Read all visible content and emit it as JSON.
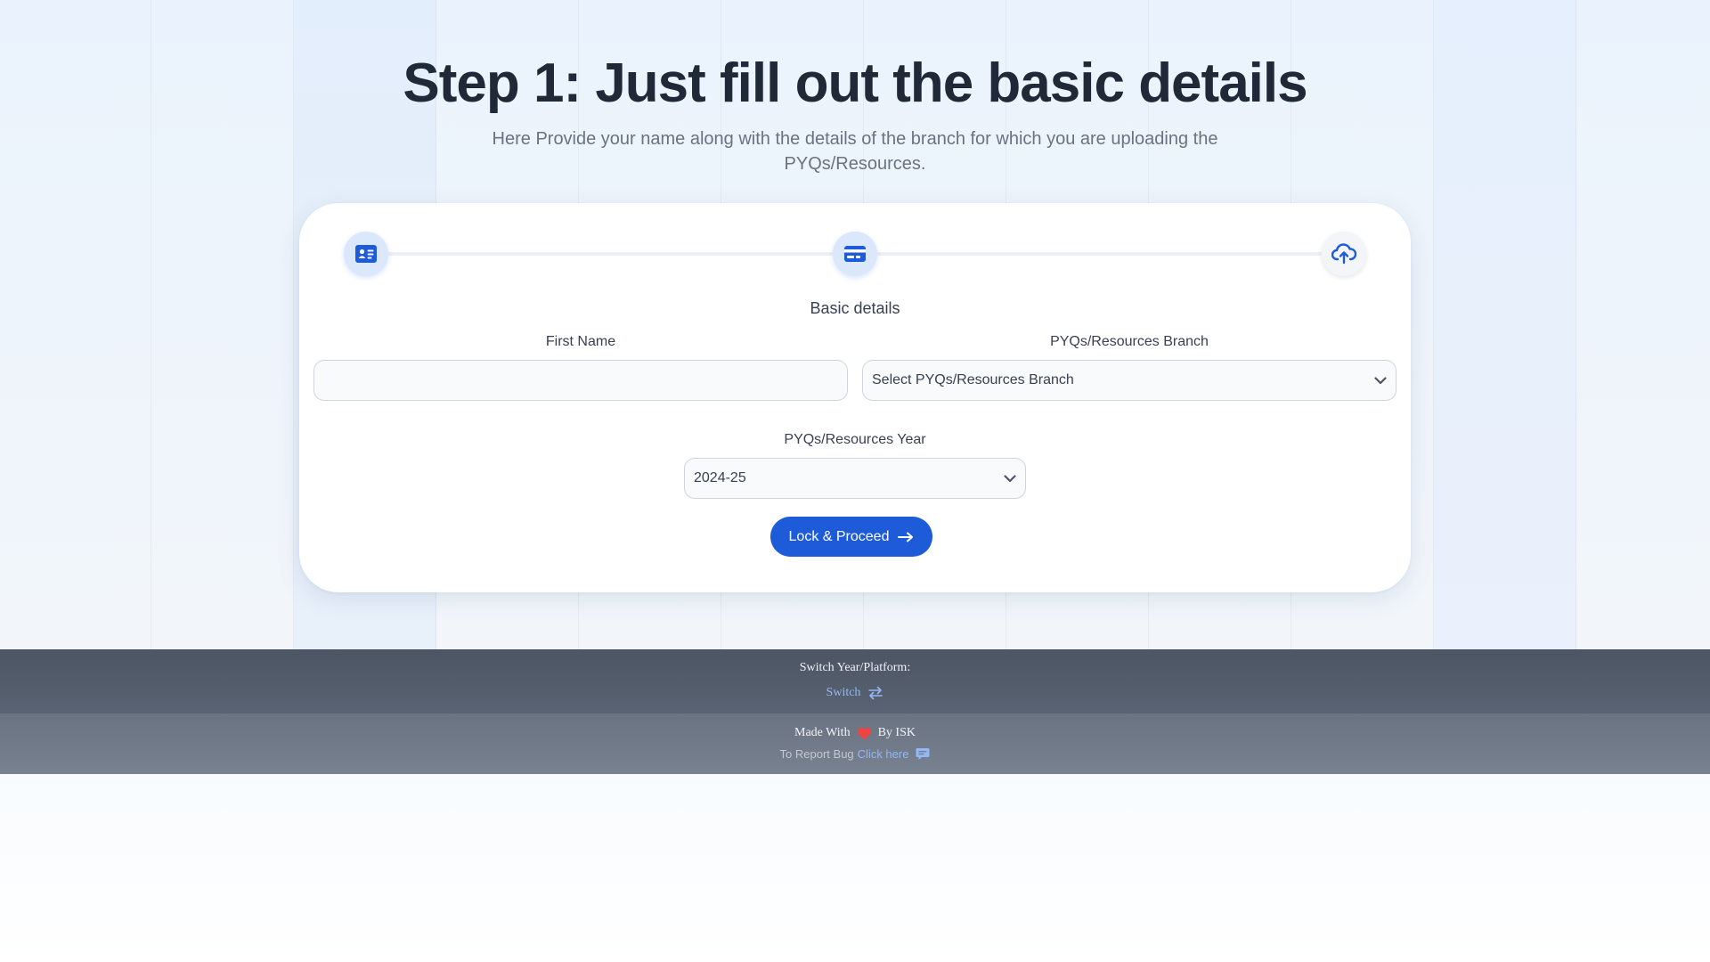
{
  "header": {
    "title": "Step 1: Just fill out the basic details",
    "subtitle": "Here Provide your name along with the details of the branch for which you are uploading the PYQs/Resources."
  },
  "stepper": {
    "steps": [
      {
        "icon": "id-card-icon",
        "state": "active"
      },
      {
        "icon": "card-icon",
        "state": "active"
      },
      {
        "icon": "cloud-upload-icon",
        "state": "inactive"
      }
    ]
  },
  "form": {
    "section_title": "Basic details",
    "first_name": {
      "label": "First Name",
      "value": "",
      "placeholder": ""
    },
    "branch": {
      "label": "PYQs/Resources Branch",
      "selected": "Select PYQs/Resources Branch"
    },
    "year": {
      "label": "PYQs/Resources Year",
      "selected": "2024-25"
    },
    "proceed_label": "Lock & Proceed"
  },
  "footer": {
    "switch_caption": "Switch Year/Platform:",
    "switch_link": "Switch",
    "made_with_prefix": "Made With",
    "made_with_suffix": "By ISK",
    "report_prefix": "To Report Bug",
    "report_link": "Click here"
  },
  "colors": {
    "accent": "#1d5bd8",
    "title": "#1f2937",
    "heart": "#ef4444",
    "link": "#93b8f5"
  }
}
